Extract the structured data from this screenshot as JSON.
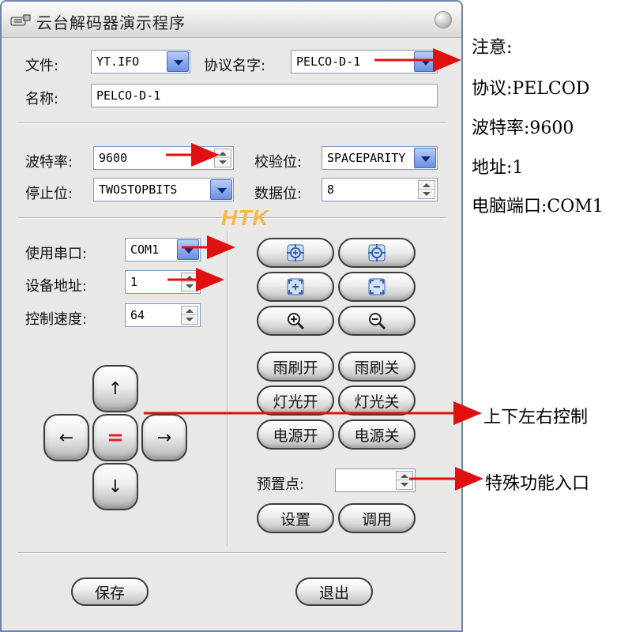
{
  "window": {
    "title": "云台解码器演示程序"
  },
  "file_section": {
    "file_label": "文件:",
    "file_value": "YT.IFO",
    "protocol_label": "协议名字:",
    "protocol_value": "PELCO-D-1",
    "name_label": "名称:",
    "name_value": "PELCO-D-1"
  },
  "serial_section": {
    "baud_label": "波特率:",
    "baud_value": "9600",
    "parity_label": "校验位:",
    "parity_value": "SPACEPARITY",
    "stopbits_label": "停止位:",
    "stopbits_value": "TWOSTOPBITS",
    "databits_label": "数据位:",
    "databits_value": "8"
  },
  "watermark": "HTK",
  "device_section": {
    "port_label": "使用串口:",
    "port_value": "COM1",
    "address_label": "设备地址:",
    "address_value": "1",
    "speed_label": "控制速度:",
    "speed_value": "64"
  },
  "dpad": {
    "up": "↑",
    "down": "↓",
    "left": "←",
    "right": "→",
    "stop": "="
  },
  "lens_buttons": [
    {
      "icon": "focus-far-icon"
    },
    {
      "icon": "focus-near-icon"
    },
    {
      "icon": "iris-open-icon"
    },
    {
      "icon": "iris-close-icon"
    },
    {
      "icon": "zoom-in-icon"
    },
    {
      "icon": "zoom-out-icon"
    }
  ],
  "aux_buttons": {
    "wiper_on": "雨刷开",
    "wiper_off": "雨刷关",
    "light_on": "灯光开",
    "light_off": "灯光关",
    "power_on": "电源开",
    "power_off": "电源关"
  },
  "preset": {
    "label": "预置点:",
    "value": "",
    "set": "设置",
    "call": "调用"
  },
  "bottom": {
    "save": "保存",
    "exit": "退出"
  },
  "annotations": {
    "heading": "注意:",
    "protocol": "协议:PELCOD",
    "baud": "波特率:9600",
    "address": "地址:1",
    "port": "电脑端口:COM1",
    "dpad_note": "上下左右控制",
    "special_note": "特殊功能入口"
  },
  "colors": {
    "arrow": "#e01010",
    "accent": "#f7b84a",
    "dropdown": "#6a8fdf"
  }
}
